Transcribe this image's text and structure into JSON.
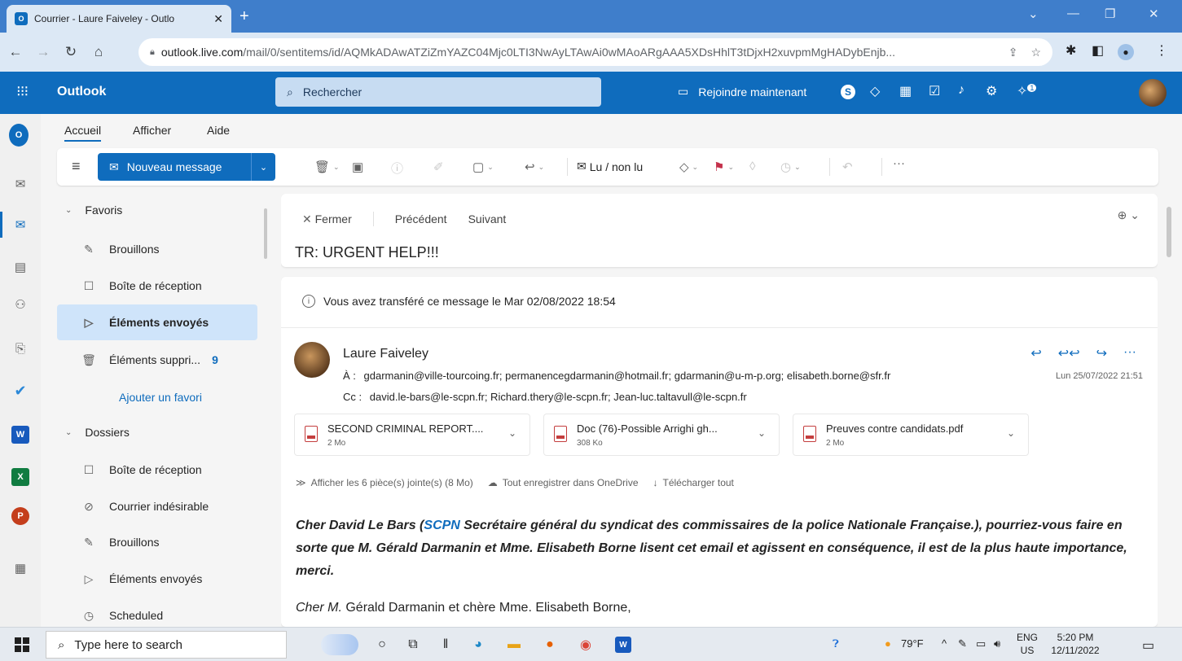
{
  "browser": {
    "tab_title": "Courrier - Laure Faiveley - Outlo",
    "url_host": "outlook.live.com",
    "url_path": "/mail/0/sentitems/id/AQMkADAwATZiZmYAZC04Mjc0LTI3NwAyLTAwAi0wMAoARgAAA5XDsHhlT3tDjxH2xuvpmMgHADybEnjb..."
  },
  "outlook": {
    "brand": "Outlook",
    "search_placeholder": "Rechercher",
    "join_label": "Rejoindre maintenant",
    "notif_count": "1"
  },
  "ribbon": {
    "tabs": [
      "Accueil",
      "Afficher",
      "Aide"
    ],
    "new_message": "Nouveau message",
    "read_unread": "Lu / non lu",
    "more": "···"
  },
  "folders": {
    "favorites_header": "Favoris",
    "favorites": [
      {
        "label": "Brouillons",
        "icon": "pencil-icon"
      },
      {
        "label": "Boîte de réception",
        "icon": "inbox-icon"
      },
      {
        "label": "Éléments envoyés",
        "icon": "send-icon",
        "selected": true
      },
      {
        "label": "Éléments suppri...",
        "icon": "trash-icon",
        "count": "9"
      }
    ],
    "add_favorite": "Ajouter un favori",
    "folders_header": "Dossiers",
    "folders": [
      {
        "label": "Boîte de réception",
        "icon": "inbox-icon"
      },
      {
        "label": "Courrier indésirable",
        "icon": "junk-icon"
      },
      {
        "label": "Brouillons",
        "icon": "pencil-icon"
      },
      {
        "label": "Éléments envoyés",
        "icon": "send-icon"
      },
      {
        "label": "Scheduled",
        "icon": "clock-icon"
      }
    ]
  },
  "message": {
    "close": "Fermer",
    "previous": "Précédent",
    "next": "Suivant",
    "subject": "TR: URGENT HELP!!!",
    "info": "Vous avez transféré ce message le Mar 02/08/2022 18:54",
    "sender": "Laure Faiveley",
    "to_label": "À :",
    "to": "gdarmanin@ville-tourcoing.fr;  permanencegdarmanin@hotmail.fr;  gdarmanin@u-m-p.org;  elisabeth.borne@sfr.fr",
    "cc_label": "Cc :",
    "cc": "david.le-bars@le-scpn.fr;  Richard.thery@le-scpn.fr;  Jean-luc.taltavull@le-scpn.fr",
    "date": "Lun 25/07/2022 21:51",
    "attachments": [
      {
        "name": "SECOND CRIMINAL REPORT....",
        "size": "2 Mo"
      },
      {
        "name": "Doc (76)-Possible Arrighi gh...",
        "size": "308 Ko"
      },
      {
        "name": "Preuves contre candidats.pdf",
        "size": "2 Mo"
      }
    ],
    "show_attachments": "Afficher les 6 pièce(s) jointe(s) (8 Mo)",
    "save_onedrive": "Tout enregistrer dans OneDrive",
    "download_all": "Télécharger tout",
    "body_intro": "Cher David Le Bars (",
    "body_scpn": "SCPN",
    "body_rest": " Secrétaire général du syndicat des commissaires de la police Nationale Française.), pourriez-vous faire en sorte que M. Gérald Darmanin et Mme. Elisabeth Borne lisent cet email et agissent en conséquence, il est de la plus haute importance, merci.",
    "greeting_it": "Cher M.",
    "greeting_rest": " Gérald Darmanin et chère Mme. Elisabeth Borne,"
  },
  "taskbar": {
    "search_placeholder": "Type here to search",
    "weather": "79°F",
    "lang": "ENG",
    "region": "US",
    "time": "5:20 PM",
    "date": "12/11/2022"
  },
  "colors": {
    "brand_blue": "#0f6cbd",
    "browser_blue": "#3f7ecb",
    "selected_folder": "#cfe4fa"
  }
}
